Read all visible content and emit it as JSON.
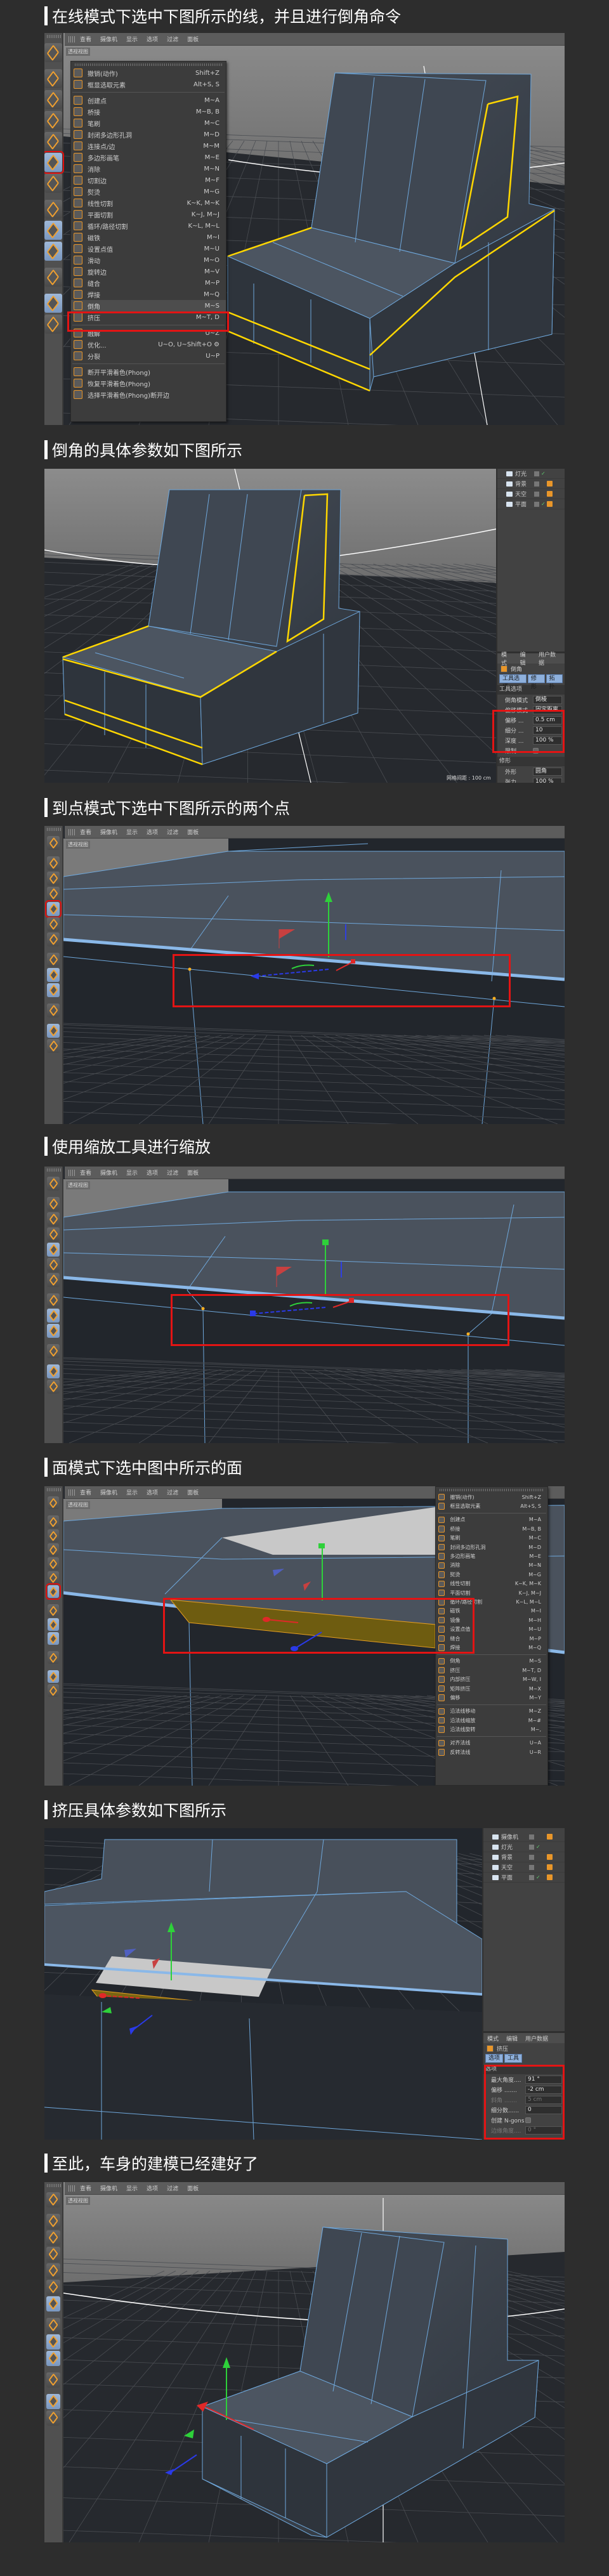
{
  "steps": [
    {
      "title": "在线模式下选中下图所示的线，并且进行倒角命令"
    },
    {
      "title": "倒角的具体参数如下图所示"
    },
    {
      "title": "到点模式下选中下图所示的两个点"
    },
    {
      "title": "使用缩放工具进行缩放"
    },
    {
      "title": "面模式下选中图中所示的面"
    },
    {
      "title": "挤压具体参数如下图所示"
    },
    {
      "title": "至此，车身的建模已经建好了"
    }
  ],
  "viewport": {
    "menu": [
      "查看",
      "摄像机",
      "显示",
      "选项",
      "过滤",
      "面板"
    ],
    "label": "透视视图"
  },
  "toolbar_icons": [
    "view-icon",
    "model-mode-icon",
    "texture-mode-icon",
    "workplane-icon",
    "point-mode-icon",
    "edge-mode-icon",
    "polygon-mode-icon",
    "axis-icon",
    "tweak-icon",
    "solo-icon",
    "snap-icon",
    "lock-workplane-icon",
    "planar-workplane-icon"
  ],
  "menu1": [
    {
      "label": "撤销(动作)",
      "shortcut": "Shift+Z"
    },
    {
      "label": "框显选取元素",
      "shortcut": "Alt+S, S"
    },
    {
      "sep": true
    },
    {
      "label": "创建点",
      "shortcut": "M~A"
    },
    {
      "label": "桥接",
      "shortcut": "M~B, B"
    },
    {
      "label": "笔刷",
      "shortcut": "M~C"
    },
    {
      "label": "封闭多边形孔洞",
      "shortcut": "M~D"
    },
    {
      "label": "连接点/边",
      "shortcut": "M~M"
    },
    {
      "label": "多边形画笔",
      "shortcut": "M~E"
    },
    {
      "label": "消除",
      "shortcut": "M~N"
    },
    {
      "label": "切割边",
      "shortcut": "M~F"
    },
    {
      "label": "熨烫",
      "shortcut": "M~G"
    },
    {
      "label": "线性切割",
      "shortcut": "K~K, M~K"
    },
    {
      "label": "平面切割",
      "shortcut": "K~J, M~J"
    },
    {
      "label": "循环/路径切割",
      "shortcut": "K~L, M~L"
    },
    {
      "label": "磁铁",
      "shortcut": "M~I"
    },
    {
      "label": "设置点值",
      "shortcut": "M~U"
    },
    {
      "label": "滑动",
      "shortcut": "M~O"
    },
    {
      "label": "旋转边",
      "shortcut": "M~V"
    },
    {
      "label": "缝合",
      "shortcut": "M~P"
    },
    {
      "label": "焊接",
      "shortcut": "M~Q"
    },
    {
      "label": "倒角",
      "shortcut": "M~S",
      "active": true
    },
    {
      "label": "挤压",
      "shortcut": "M~T, D"
    },
    {
      "sep": true
    },
    {
      "label": "融解",
      "shortcut": "U~Z"
    },
    {
      "label": "优化...",
      "shortcut": "U~O, U~Shift+O ⚙"
    },
    {
      "label": "分裂",
      "shortcut": "U~P"
    },
    {
      "sep": true
    },
    {
      "label": "断开平滑着色(Phong)",
      "shortcut": ""
    },
    {
      "label": "恢复平滑着色(Phong)",
      "shortcut": ""
    },
    {
      "label": "选择平滑着色(Phong)断开边",
      "shortcut": ""
    }
  ],
  "menu5": [
    {
      "label": "撤销(动作)",
      "shortcut": "Shift+Z"
    },
    {
      "label": "框显选取元素",
      "shortcut": "Alt+S, S"
    },
    {
      "sep": true
    },
    {
      "label": "创建点",
      "shortcut": "M~A"
    },
    {
      "label": "桥接",
      "shortcut": "M~B, B"
    },
    {
      "label": "笔刷",
      "shortcut": "M~C"
    },
    {
      "label": "封闭多边形孔洞",
      "shortcut": "M~D"
    },
    {
      "label": "多边形画笔",
      "shortcut": "M~E"
    },
    {
      "label": "消除",
      "shortcut": "M~N"
    },
    {
      "label": "熨烫",
      "shortcut": "M~G"
    },
    {
      "label": "线性切割",
      "shortcut": "K~K, M~K"
    },
    {
      "label": "平面切割",
      "shortcut": "K~J, M~J"
    },
    {
      "label": "循环/路径切割",
      "shortcut": "K~L, M~L"
    },
    {
      "label": "磁铁",
      "shortcut": "M~I"
    },
    {
      "label": "镜像",
      "shortcut": "M~H"
    },
    {
      "label": "设置点值",
      "shortcut": "M~U"
    },
    {
      "label": "缝合",
      "shortcut": "M~P"
    },
    {
      "label": "焊接",
      "shortcut": "M~Q"
    },
    {
      "sep": true
    },
    {
      "label": "倒角",
      "shortcut": "M~S"
    },
    {
      "label": "挤压",
      "shortcut": "M~T, D"
    },
    {
      "label": "内部挤压",
      "shortcut": "M~W, I"
    },
    {
      "label": "矩阵挤压",
      "shortcut": "M~X"
    },
    {
      "label": "偏移",
      "shortcut": "M~Y"
    },
    {
      "sep": true
    },
    {
      "label": "沿法线移动",
      "shortcut": "M~Z"
    },
    {
      "label": "沿法线缩放",
      "shortcut": "M~#"
    },
    {
      "label": "沿法线旋转",
      "shortcut": "M~,"
    },
    {
      "sep": true
    },
    {
      "label": "对齐法线",
      "shortcut": "U~A"
    },
    {
      "label": "反转法线",
      "shortcut": "U~R"
    }
  ],
  "bevel_panel": {
    "objects": [
      "灯光",
      "背景",
      "天空",
      "平面"
    ],
    "tabs": [
      "模式",
      "编辑",
      "用户数据"
    ],
    "tool_name": "倒角",
    "subtabs": [
      "工具选项",
      "修形",
      "拓扑"
    ],
    "section": "工具选项",
    "rows": [
      {
        "label": "倒角模式",
        "value": "倒棱"
      },
      {
        "label": "偏移模式",
        "value": "固定距离"
      },
      {
        "label": "偏移 ...",
        "value": "0.5 cm"
      },
      {
        "label": "细分 ...",
        "value": "10"
      },
      {
        "label": "深度 ...",
        "value": "100 %"
      }
    ],
    "limit_label": "限制 ...",
    "section2": "修形",
    "rows2": [
      {
        "label": "外形",
        "value": "圆角"
      },
      {
        "label": "张力",
        "value": "100 %"
      }
    ],
    "grid_spacing": "网格间距 : 100 cm"
  },
  "extrude_panel": {
    "objects": [
      "摄像机",
      "灯光",
      "背景",
      "天空",
      "平面"
    ],
    "tabs": [
      "模式",
      "编辑",
      "用户数据"
    ],
    "tool_name": "挤压",
    "subtabs": [
      "选项",
      "工具"
    ],
    "section": "选项",
    "rows": [
      {
        "label": "最大角度....",
        "value": "91 °"
      },
      {
        "label": "偏移 .......",
        "value": "-2 cm"
      },
      {
        "label": "斜角 .......",
        "value": "5 cm",
        "disabled": true
      },
      {
        "label": "细分数......",
        "value": "0"
      }
    ],
    "ngons_label": "创建 N-gons",
    "edge_angle": {
      "label": "边缘角度....",
      "value": "0 °"
    }
  },
  "colors": {
    "background": "#2d2d2d",
    "highlight_box": "#e31414",
    "selection": "#ffd700",
    "wire": "#6fa8dc",
    "accent": "#e8962a"
  }
}
